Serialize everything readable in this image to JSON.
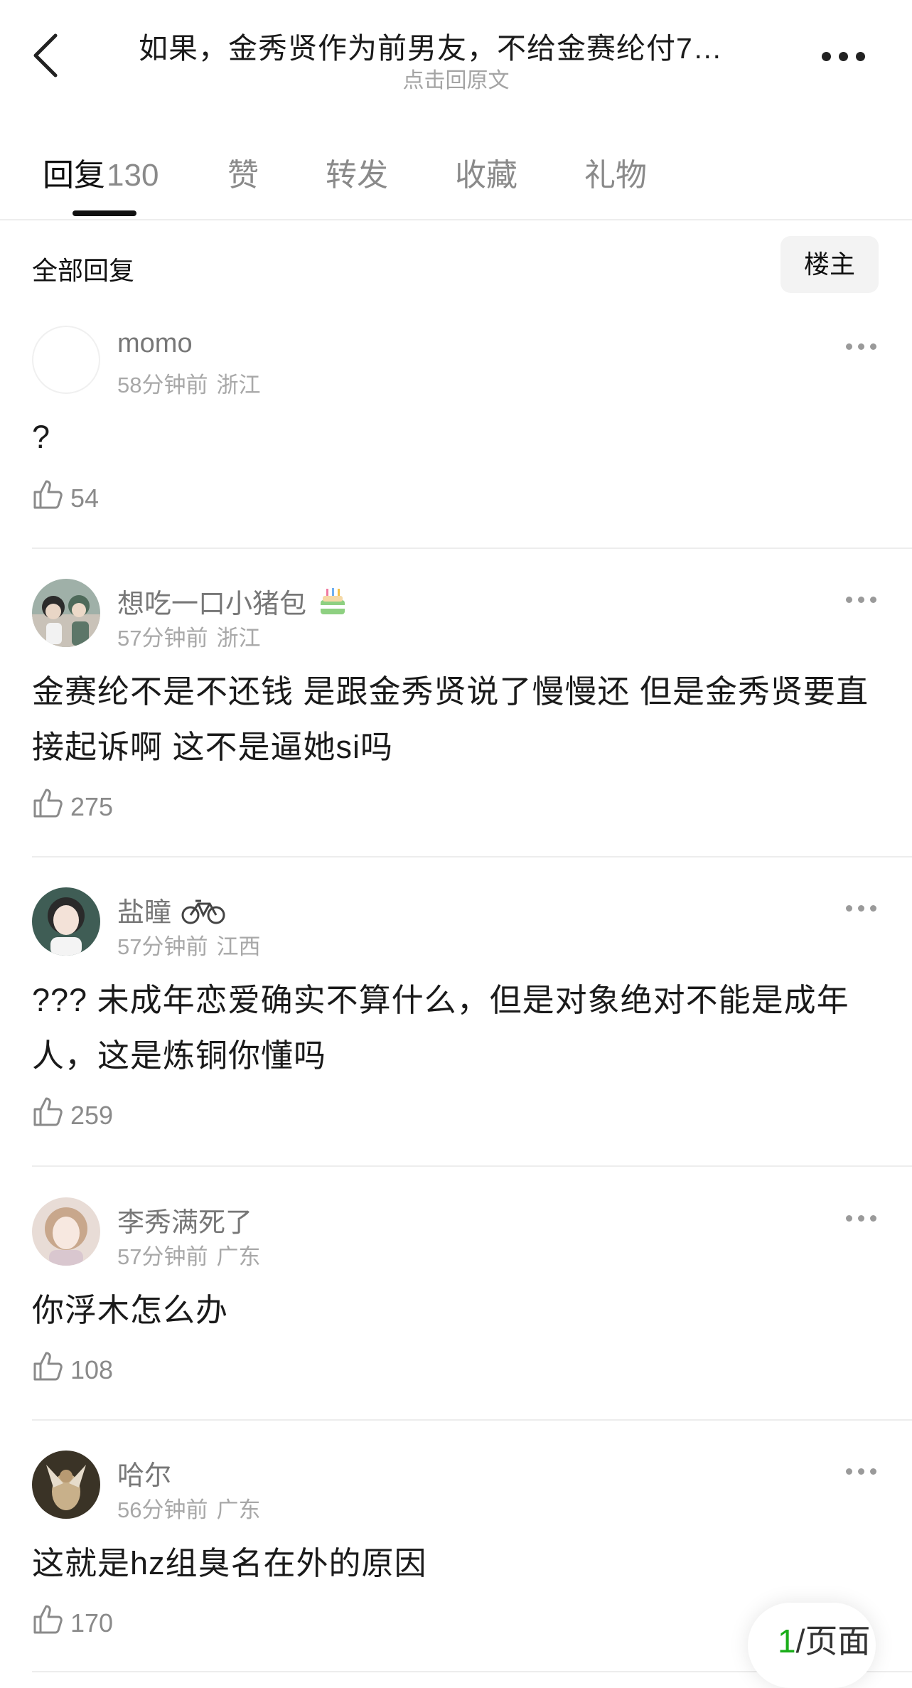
{
  "header": {
    "back_icon": "chevron-left-icon",
    "title": "如果，金秀贤作为前男友，不给金赛纶付7…",
    "subtitle": "点击回原文",
    "more_icon": "more-horizontal-icon"
  },
  "tabs": [
    {
      "label": "回复",
      "count": "130",
      "active": true
    },
    {
      "label": "赞",
      "count": "",
      "active": false
    },
    {
      "label": "转发",
      "count": "",
      "active": false
    },
    {
      "label": "收藏",
      "count": "",
      "active": false
    },
    {
      "label": "礼物",
      "count": "",
      "active": false
    }
  ],
  "filter": {
    "label": "全部回复",
    "op_button": "楼主"
  },
  "comments": [
    {
      "username": "momo",
      "time": "58分钟前",
      "location": "浙江",
      "text": "?",
      "likes": "54",
      "badge": ""
    },
    {
      "username": "想吃一口小猪包",
      "time": "57分钟前",
      "location": "浙江",
      "text": "金赛纶不是不还钱 是跟金秀贤说了慢慢还 但是金秀贤要直接起诉啊 这不是逼她si吗",
      "likes": "275",
      "badge": "birthday-cake-icon"
    },
    {
      "username": "盐瞳",
      "time": "57分钟前",
      "location": "江西",
      "text": "??? 未成年恋爱确实不算什么，但是对象绝对不能是成年人，这是炼铜你懂吗",
      "likes": "259",
      "badge": "bicycle-icon"
    },
    {
      "username": "李秀满死了",
      "time": "57分钟前",
      "location": "广东",
      "text": "你浮木怎么办",
      "likes": "108",
      "badge": ""
    },
    {
      "username": "哈尔",
      "time": "56分钟前",
      "location": "广东",
      "text": "这就是hz组臭名在外的原因",
      "likes": "170",
      "badge": ""
    }
  ],
  "page_indicator": {
    "number": "1",
    "suffix": "/页面"
  },
  "colors": {
    "accent": "#111111",
    "muted_text": "#a8a8a8",
    "page_number": "#1aad19"
  }
}
